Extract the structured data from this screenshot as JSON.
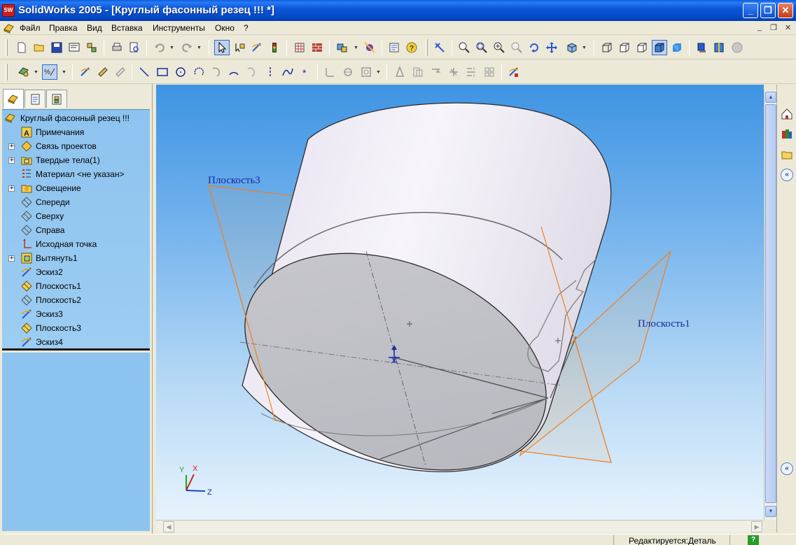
{
  "window": {
    "title": "SolidWorks 2005 - [Круглый фасонный резец !!! *]",
    "icon_label": "SW",
    "minimize": "_",
    "maximize": "❐",
    "close": "✕"
  },
  "menu": {
    "items": [
      "Файл",
      "Правка",
      "Вид",
      "Вставка",
      "Инструменты",
      "Окно",
      "?"
    ],
    "mdi_minimize": "_",
    "mdi_restore": "❐",
    "mdi_close": "✕"
  },
  "feature_tree": {
    "tabs": [
      "feature-manager",
      "property-manager",
      "configuration-manager"
    ],
    "root": "Круглый фасонный резец !!!",
    "items": [
      {
        "label": "Примечания",
        "icon": "annotations-icon",
        "expandable": false
      },
      {
        "label": "Связь проектов",
        "icon": "design-binder-icon",
        "expandable": true
      },
      {
        "label": "Твердые тела(1)",
        "icon": "solid-bodies-icon",
        "expandable": true
      },
      {
        "label": "Материал <не указан>",
        "icon": "material-icon",
        "expandable": false
      },
      {
        "label": "Освещение",
        "icon": "lighting-icon",
        "expandable": true
      },
      {
        "label": "Спереди",
        "icon": "plane-icon",
        "expandable": false
      },
      {
        "label": "Сверху",
        "icon": "plane-icon",
        "expandable": false
      },
      {
        "label": "Справа",
        "icon": "plane-icon",
        "expandable": false
      },
      {
        "label": "Исходная точка",
        "icon": "origin-icon",
        "expandable": false
      },
      {
        "label": "Вытянуть1",
        "icon": "extrude-icon",
        "expandable": true
      },
      {
        "label": "Эскиз2",
        "icon": "sketch-icon",
        "expandable": false
      },
      {
        "label": "Плоскость1",
        "icon": "plane-selected-icon",
        "expandable": false
      },
      {
        "label": "Плоскость2",
        "icon": "plane-icon",
        "expandable": false
      },
      {
        "label": "Эскиз3",
        "icon": "sketch-icon",
        "expandable": false
      },
      {
        "label": "Плоскость3",
        "icon": "plane-selected-icon",
        "expandable": false
      },
      {
        "label": "Эскиз4",
        "icon": "sketch-icon",
        "expandable": false
      }
    ]
  },
  "viewport": {
    "plane_labels": [
      "Плоскость3",
      "Плоскость1"
    ],
    "triad": {
      "x": "X",
      "y": "Y",
      "z": "Z"
    }
  },
  "status": {
    "text": "Редактируется:Деталь",
    "help": "?"
  },
  "colors": {
    "plane_outline": "#f08020",
    "plane_label": "#1a2a9a",
    "viewport_top": "#3e94e3",
    "viewport_bottom": "#e7f3fd",
    "tree_background": "#8dc3ef"
  }
}
